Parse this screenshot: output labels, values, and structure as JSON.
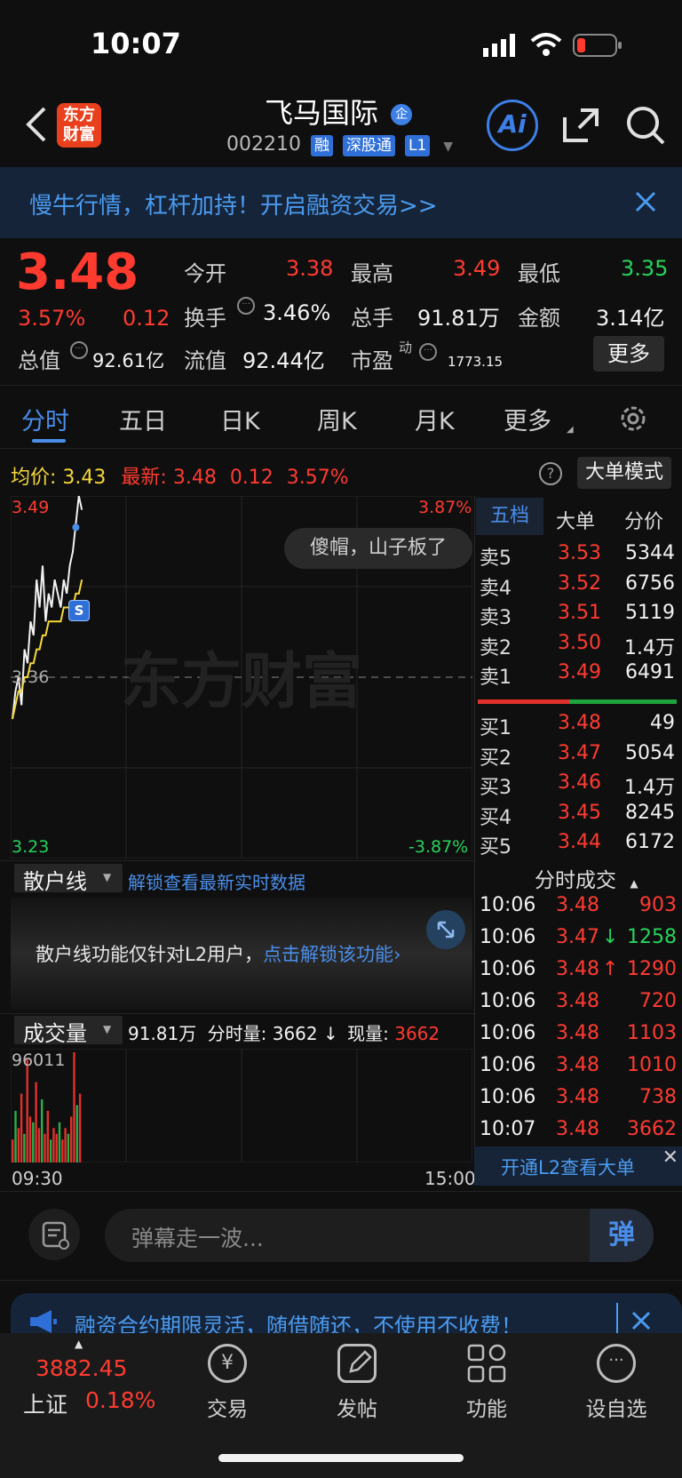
{
  "status_bar": {
    "time": "10:07"
  },
  "header": {
    "logo_text_1": "东方",
    "logo_text_2": "财富",
    "stock_name": "飞马国际",
    "company_badge": "企",
    "code": "002210",
    "tags": [
      "融",
      "深股通",
      "L1"
    ],
    "ai_label": "Ai"
  },
  "banner": {
    "text": "慢牛行情，杠杆加持！开启融资交易>>"
  },
  "quote": {
    "price": "3.48",
    "change_pct": "3.57%",
    "change": "0.12",
    "fields": {
      "open_label": "今开",
      "open": "3.38",
      "high_label": "最高",
      "high": "3.49",
      "low_label": "最低",
      "low": "3.35",
      "turnover_label": "换手",
      "turnover": "3.46%",
      "volume_label": "总手",
      "volume": "91.81万",
      "amount_label": "金额",
      "amount": "3.14亿",
      "mktcap_label": "总值",
      "mktcap": "92.61亿",
      "float_label": "流值",
      "float": "92.44亿",
      "pe_label": "市盈",
      "pe_sup": "动",
      "pe": "1773.15"
    },
    "more_button": "更多"
  },
  "tabs": [
    "分时",
    "五日",
    "日K",
    "周K",
    "月K",
    "更多"
  ],
  "avg_bar": {
    "avg_label": "均价:",
    "avg": "3.43",
    "latest_label": "最新:",
    "latest": "3.48",
    "change": "0.12",
    "pct": "3.57%",
    "big_order_button": "大单模式"
  },
  "chart": {
    "y_top": "3.49",
    "y_bottom": "3.23",
    "y_mid": "3.36",
    "pct_top": "3.87%",
    "pct_bottom": "-3.87%",
    "watermark": "东方财富",
    "bubble": "傻帽，山子板了",
    "marker": "S"
  },
  "chart_data": {
    "type": "line",
    "title": "",
    "ylim": [
      3.23,
      3.49
    ],
    "series": [
      {
        "values": [
          3.33,
          3.35,
          3.36,
          3.34,
          3.38,
          3.37,
          3.4,
          3.39,
          3.43,
          3.41,
          3.44,
          3.4,
          3.42,
          3.41,
          3.43,
          3.42,
          3.41,
          3.43,
          3.42,
          3.44,
          3.45,
          3.47,
          3.49,
          3.48
        ]
      },
      {
        "values": [
          3.33,
          3.34,
          3.35,
          3.35,
          3.36,
          3.36,
          3.37,
          3.37,
          3.38,
          3.38,
          3.39,
          3.39,
          3.4,
          3.4,
          3.4,
          3.4,
          3.4,
          3.41,
          3.41,
          3.41,
          3.41,
          3.42,
          3.42,
          3.43
        ]
      }
    ],
    "volume": [
      20,
      45,
      30,
      60,
      25,
      90,
      40,
      35,
      70,
      30,
      55,
      25,
      45,
      20,
      30,
      25,
      35,
      20,
      30,
      25,
      40,
      96,
      50,
      60
    ]
  },
  "orderbook": {
    "tabs": [
      "五档",
      "大单",
      "分价"
    ],
    "sell": [
      {
        "label": "卖5",
        "price": "3.53",
        "vol": "5344"
      },
      {
        "label": "卖4",
        "price": "3.52",
        "vol": "6756"
      },
      {
        "label": "卖3",
        "price": "3.51",
        "vol": "5119"
      },
      {
        "label": "卖2",
        "price": "3.50",
        "vol": "1.4万"
      },
      {
        "label": "卖1",
        "price": "3.49",
        "vol": "6491"
      }
    ],
    "buy": [
      {
        "label": "买1",
        "price": "3.48",
        "vol": "49"
      },
      {
        "label": "买2",
        "price": "3.47",
        "vol": "5054"
      },
      {
        "label": "买3",
        "price": "3.46",
        "vol": "1.4万"
      },
      {
        "label": "买4",
        "price": "3.45",
        "vol": "8245"
      },
      {
        "label": "买5",
        "price": "3.44",
        "vol": "6172"
      }
    ]
  },
  "trades": {
    "title": "分时成交",
    "rows": [
      {
        "time": "10:06",
        "price": "3.48",
        "vol": "903",
        "dir": ""
      },
      {
        "time": "10:06",
        "price": "3.47",
        "vol": "1258",
        "dir": "↓"
      },
      {
        "time": "10:06",
        "price": "3.48",
        "vol": "1290",
        "dir": "↑"
      },
      {
        "time": "10:06",
        "price": "3.48",
        "vol": "720",
        "dir": ""
      },
      {
        "time": "10:06",
        "price": "3.48",
        "vol": "1103",
        "dir": ""
      },
      {
        "time": "10:06",
        "price": "3.48",
        "vol": "1010",
        "dir": ""
      },
      {
        "time": "10:06",
        "price": "3.48",
        "vol": "738",
        "dir": ""
      },
      {
        "time": "10:07",
        "price": "3.48",
        "vol": "3662",
        "dir": ""
      }
    ],
    "l2_link": "开通L2查看大单"
  },
  "retail": {
    "select": "散户线",
    "link": "解锁查看最新实时数据",
    "notice": "散户线功能仅针对L2用户，",
    "notice_link": "点击解锁该功能"
  },
  "volume_panel": {
    "select": "成交量",
    "total": "91.81万",
    "minute_label": "分时量:",
    "minute": "3662",
    "arrow": "↓",
    "current_label": "现量:",
    "current": "3662",
    "max": "96011",
    "start": "09:30",
    "end": "15:00"
  },
  "danmaku": {
    "placeholder": "弹幕走一波...",
    "send": "弹"
  },
  "promo": {
    "text": "融资合约期限灵活，随借随还，不使用不收费！"
  },
  "bottom_nav": {
    "index_value": "3882.45",
    "index_name": "上证",
    "index_pct": "0.18%",
    "items": [
      "交易",
      "发帖",
      "功能",
      "设自选"
    ]
  }
}
